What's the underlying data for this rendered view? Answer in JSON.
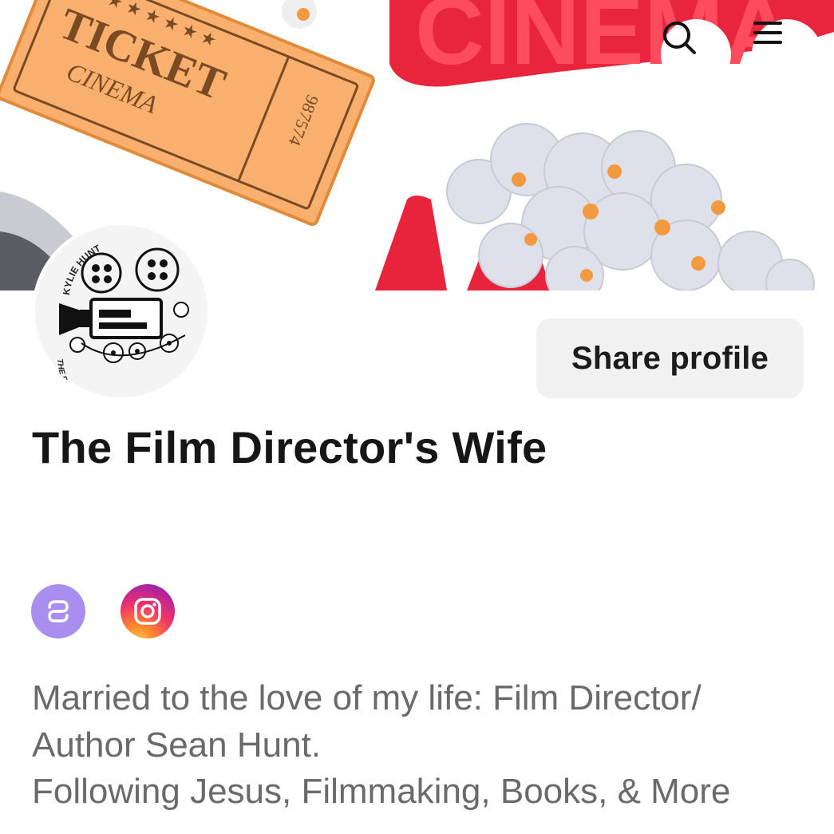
{
  "header": {
    "search_label": "Search",
    "menu_label": "Menu"
  },
  "cover": {
    "ticket_line1": "TICKET",
    "ticket_line2": "CINEMA",
    "ticket_number": "987574",
    "sign_text": "CINEMA"
  },
  "avatar": {
    "top_text": "KYLIE HUNT",
    "bottom_text": "THE FILM DIRECTOR'S WIFE"
  },
  "profile": {
    "share_label": "Share profile",
    "name": "The Film Director's Wife"
  },
  "social": [
    {
      "name": "linktree",
      "color": "#a98ef0"
    },
    {
      "name": "instagram",
      "color": "#e1306c"
    }
  ],
  "bio": {
    "lines": [
      "Married to the love of my life: Film Director/",
      "Author Sean Hunt.",
      "Following Jesus, Filmmaking, Books, & More"
    ]
  }
}
